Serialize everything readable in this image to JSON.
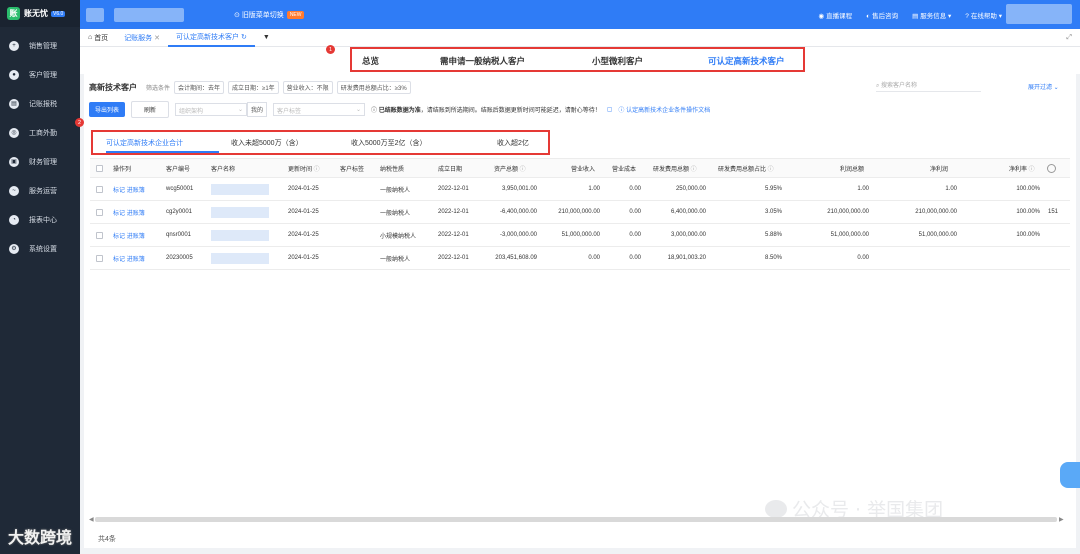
{
  "app": {
    "logo_text": "账无忧",
    "logo_badge": "V6.0"
  },
  "sidebar": {
    "items": [
      {
        "label": "销售管理",
        "icon": "plus-circle-icon"
      },
      {
        "label": "客户管理",
        "icon": "user-icon"
      },
      {
        "label": "记账报税",
        "icon": "ledger-icon"
      },
      {
        "label": "工商外勤",
        "icon": "briefcase-icon"
      },
      {
        "label": "财务管理",
        "icon": "wallet-icon"
      },
      {
        "label": "服务运营",
        "icon": "chart-icon"
      },
      {
        "label": "报表中心",
        "icon": "pie-icon"
      },
      {
        "label": "系统设置",
        "icon": "gear-icon"
      }
    ],
    "badge_2": "2"
  },
  "topbar": {
    "switch_label": "旧版菜单切换",
    "new_badge": "NEW",
    "links": [
      "直播课程",
      "售后咨询",
      "服务信息",
      "在线帮助"
    ]
  },
  "tabs": {
    "home": "首页",
    "tab1": "记账服务",
    "tab2": "可认定高新技术客户"
  },
  "segments": {
    "badge_1": "1",
    "items": [
      "总览",
      "需申请一般纳税人客户",
      "小型微利客户",
      "可认定高新技术客户"
    ]
  },
  "filters": {
    "page_name": "高新技术客户",
    "label": "筛选条件",
    "chips": [
      "会计期间：去年",
      "成立日期：≥1年",
      "营业收入：不限",
      "研发费用总额占比：≥3%"
    ],
    "search_placeholder": "搜索客户名称",
    "expand": "展开过滤"
  },
  "actions": {
    "export": "导出列表",
    "refresh": "刷新",
    "org_placeholder": "组织架构",
    "mine": "我的",
    "tag_placeholder": "客户标签",
    "notice_bold": "已结账数据为准",
    "notice_rest": "，请结账到所选期间。结账后数据更新时间可能延迟，请耐心等待！",
    "doc_link": "认定高新技术企业条件操作文档"
  },
  "subtabs": [
    "可认定高新技术企业合计",
    "收入未超5000万（含）",
    "收入5000万至2亿（含）",
    "收入超2亿"
  ],
  "table": {
    "headers": [
      "操作列",
      "客户编号",
      "客户名称",
      "更新时间",
      "客户标签",
      "纳税性质",
      "成立日期",
      "资产总额",
      "营业收入",
      "营业成本",
      "研发费用总额",
      "研发费用总额占比",
      "利润总额",
      "净利润",
      "净利率"
    ],
    "row_action_1": "标记",
    "row_action_2": "进账簿",
    "rows": [
      {
        "code": "wcg50001",
        "updated": "2024-01-25",
        "tax": "一般纳税人",
        "founded": "2022-12-01",
        "assets": "3,950,001.00",
        "revenue": "1.00",
        "cost": "0.00",
        "rd": "250,000.00",
        "rd_ratio": "5.95%",
        "profit": "1.00",
        "net_profit": "1.00",
        "net_margin": "100.00%",
        "extra": ""
      },
      {
        "code": "cg2y0001",
        "updated": "2024-01-25",
        "tax": "一般纳税人",
        "founded": "2022-12-01",
        "assets": "-6,400,000.00",
        "revenue": "210,000,000.00",
        "cost": "0.00",
        "rd": "6,400,000.00",
        "rd_ratio": "3.05%",
        "profit": "210,000,000.00",
        "net_profit": "210,000,000.00",
        "net_margin": "100.00%",
        "extra": "151"
      },
      {
        "code": "qnsr0001",
        "updated": "2024-01-25",
        "tax": "小规模纳税人",
        "founded": "2022-12-01",
        "assets": "-3,000,000.00",
        "revenue": "51,000,000.00",
        "cost": "0.00",
        "rd": "3,000,000.00",
        "rd_ratio": "5.88%",
        "profit": "51,000,000.00",
        "net_profit": "51,000,000.00",
        "net_margin": "100.00%",
        "extra": ""
      },
      {
        "code": "20230005",
        "updated": "2024-01-25",
        "tax": "一般纳税人",
        "founded": "2022-12-01",
        "assets": "203,451,608.09",
        "revenue": "0.00",
        "cost": "0.00",
        "rd": "18,901,003.20",
        "rd_ratio": "8.50%",
        "profit": "0.00",
        "net_profit": "",
        "net_margin": "",
        "extra": ""
      }
    ]
  },
  "footer": {
    "total": "共4条"
  },
  "watermark": {
    "right": "公众号 · 举国集团",
    "left": "大数跨境"
  }
}
